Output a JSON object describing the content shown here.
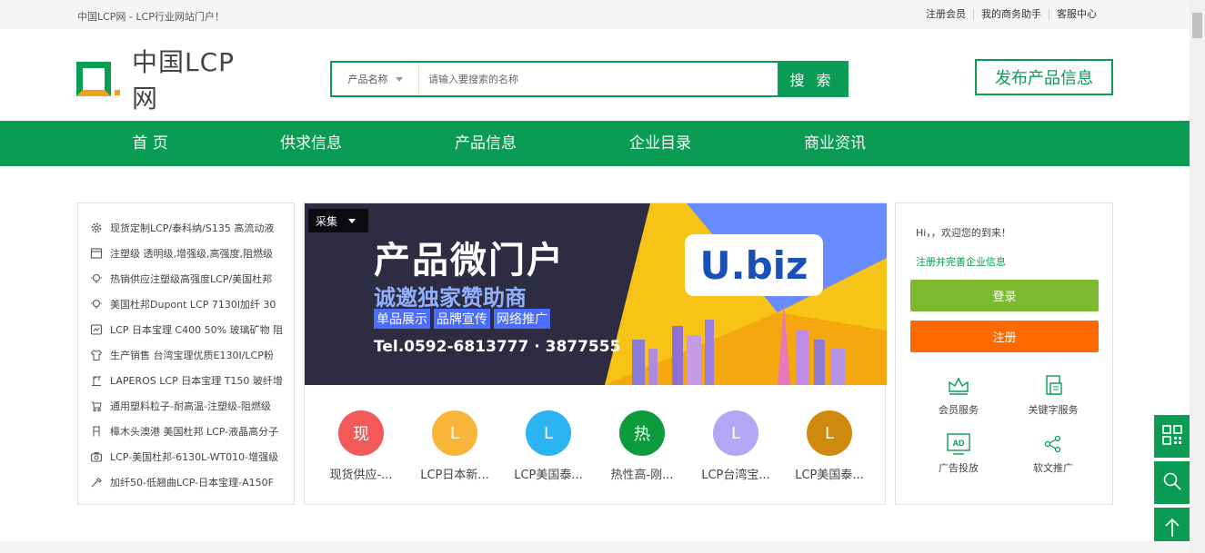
{
  "topbar": {
    "welcome": "中国LCP网 - LCP行业网站门户！",
    "links": [
      "注册会员",
      "我的商务助手",
      "客服中心"
    ]
  },
  "logo": {
    "text": "中国LCP网"
  },
  "search": {
    "category": "产品名称",
    "placeholder": "请输入要搜索的名称",
    "button": "搜 索"
  },
  "publish_button": "发布产品信息",
  "nav": [
    "首 页",
    "供求信息",
    "产品信息",
    "企业目录",
    "商业资讯"
  ],
  "sidebar": {
    "items": [
      {
        "icon": "gear-icon",
        "text": "现货定制LCP/泰科纳/S135 高流动液"
      },
      {
        "icon": "box-icon",
        "text": "注塑级 透明级,增强级,高强度,阻燃级"
      },
      {
        "icon": "bulb-icon",
        "text": "热销供应注塑级高强度LCP/美国杜邦"
      },
      {
        "icon": "bulb-icon",
        "text": "美国杜邦Dupont LCP 7130l加纤 30"
      },
      {
        "icon": "chip-icon",
        "text": "LCP 日本宝理 C400 50% 玻璃矿物 阻"
      },
      {
        "icon": "shirt-icon",
        "text": "生产销售 台湾宝理优质E130I/LCP粉"
      },
      {
        "icon": "crane-icon",
        "text": "LAPEROS LCP 日本宝理 T150 玻纤增"
      },
      {
        "icon": "stroller-icon",
        "text": "通用塑料粒子-耐高温-注塑级-阻燃级"
      },
      {
        "icon": "chair-icon",
        "text": "樟木头澳港 美国杜邦 LCP-液晶高分子"
      },
      {
        "icon": "camera-icon",
        "text": "LCP-美国杜邦-6130L-WT010-增强级"
      },
      {
        "icon": "tool-icon",
        "text": "加纤50-低翘曲LCP-日本宝理-A150F"
      }
    ]
  },
  "banner": {
    "collect_label": "采集",
    "title": "产品微门户",
    "subtitle": "诚邀独家赞助商",
    "tags": [
      "单品展示",
      "品牌宣传",
      "网络推广"
    ],
    "tel": "Tel.0592-6813777 · 3877555",
    "brand": "U.biz"
  },
  "products": [
    {
      "badge": "现",
      "color": "#f25a5a",
      "label": "现货供应-..."
    },
    {
      "badge": "L",
      "color": "#f9b53a",
      "label": "LCP日本新..."
    },
    {
      "badge": "L",
      "color": "#2bb3f3",
      "label": "LCP美国泰..."
    },
    {
      "badge": "热",
      "color": "#0a9c3a",
      "label": "热性高-刚..."
    },
    {
      "badge": "L",
      "color": "#b4a6f5",
      "label": "LCP台湾宝..."
    },
    {
      "badge": "L",
      "color": "#cf8a0e",
      "label": "LCP美国泰..."
    }
  ],
  "userbox": {
    "greeting": "Hi，，欢迎您的到来！",
    "register_link": "注册并完善企业信息",
    "login": "登录",
    "register": "注册",
    "services": [
      "会员服务",
      "关键字服务",
      "广告投放",
      "软文推广"
    ],
    "ad_icon_text": "AD"
  },
  "colors": {
    "brand_green": "#0a9c52",
    "login_green": "#7cb830",
    "register_orange": "#ff6a00"
  }
}
